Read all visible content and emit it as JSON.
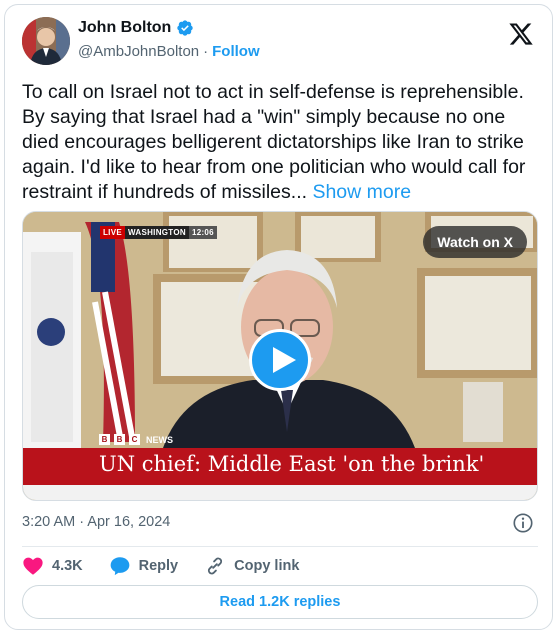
{
  "author": {
    "name": "John Bolton",
    "handle": "@AmbJohnBolton",
    "separator": "·",
    "follow_label": "Follow"
  },
  "tweet": {
    "text": "To call on Israel not to act in self-defense is reprehensible. By saying that Israel had a \"win\" simply because no one died encourages belligerent dictatorships like Iran to strike again. I'd like to hear from one politician who would call for restraint if hundreds of missiles...",
    "show_more_label": "Show more"
  },
  "video": {
    "live_label": "LIVE",
    "location_label": "WASHINGTON",
    "clock": "12:06",
    "watch_label": "Watch on X",
    "news_brand": "NEWS",
    "bbc_letters": [
      "B",
      "B",
      "C"
    ],
    "headline": "UN chief: Middle East 'on the brink'"
  },
  "meta": {
    "timestamp": "3:20 AM · Apr 16, 2024"
  },
  "actions": {
    "likes": "4.3K",
    "reply_label": "Reply",
    "copy_label": "Copy link",
    "read_replies_label": "Read 1.2K replies"
  },
  "colors": {
    "accent": "#1d9bf0",
    "like": "#f91880",
    "bbc_red": "#b9121b"
  },
  "icons": [
    "verified-badge-icon",
    "x-logo-icon",
    "play-icon",
    "info-icon",
    "heart-icon",
    "reply-bubble-icon",
    "link-icon"
  ]
}
